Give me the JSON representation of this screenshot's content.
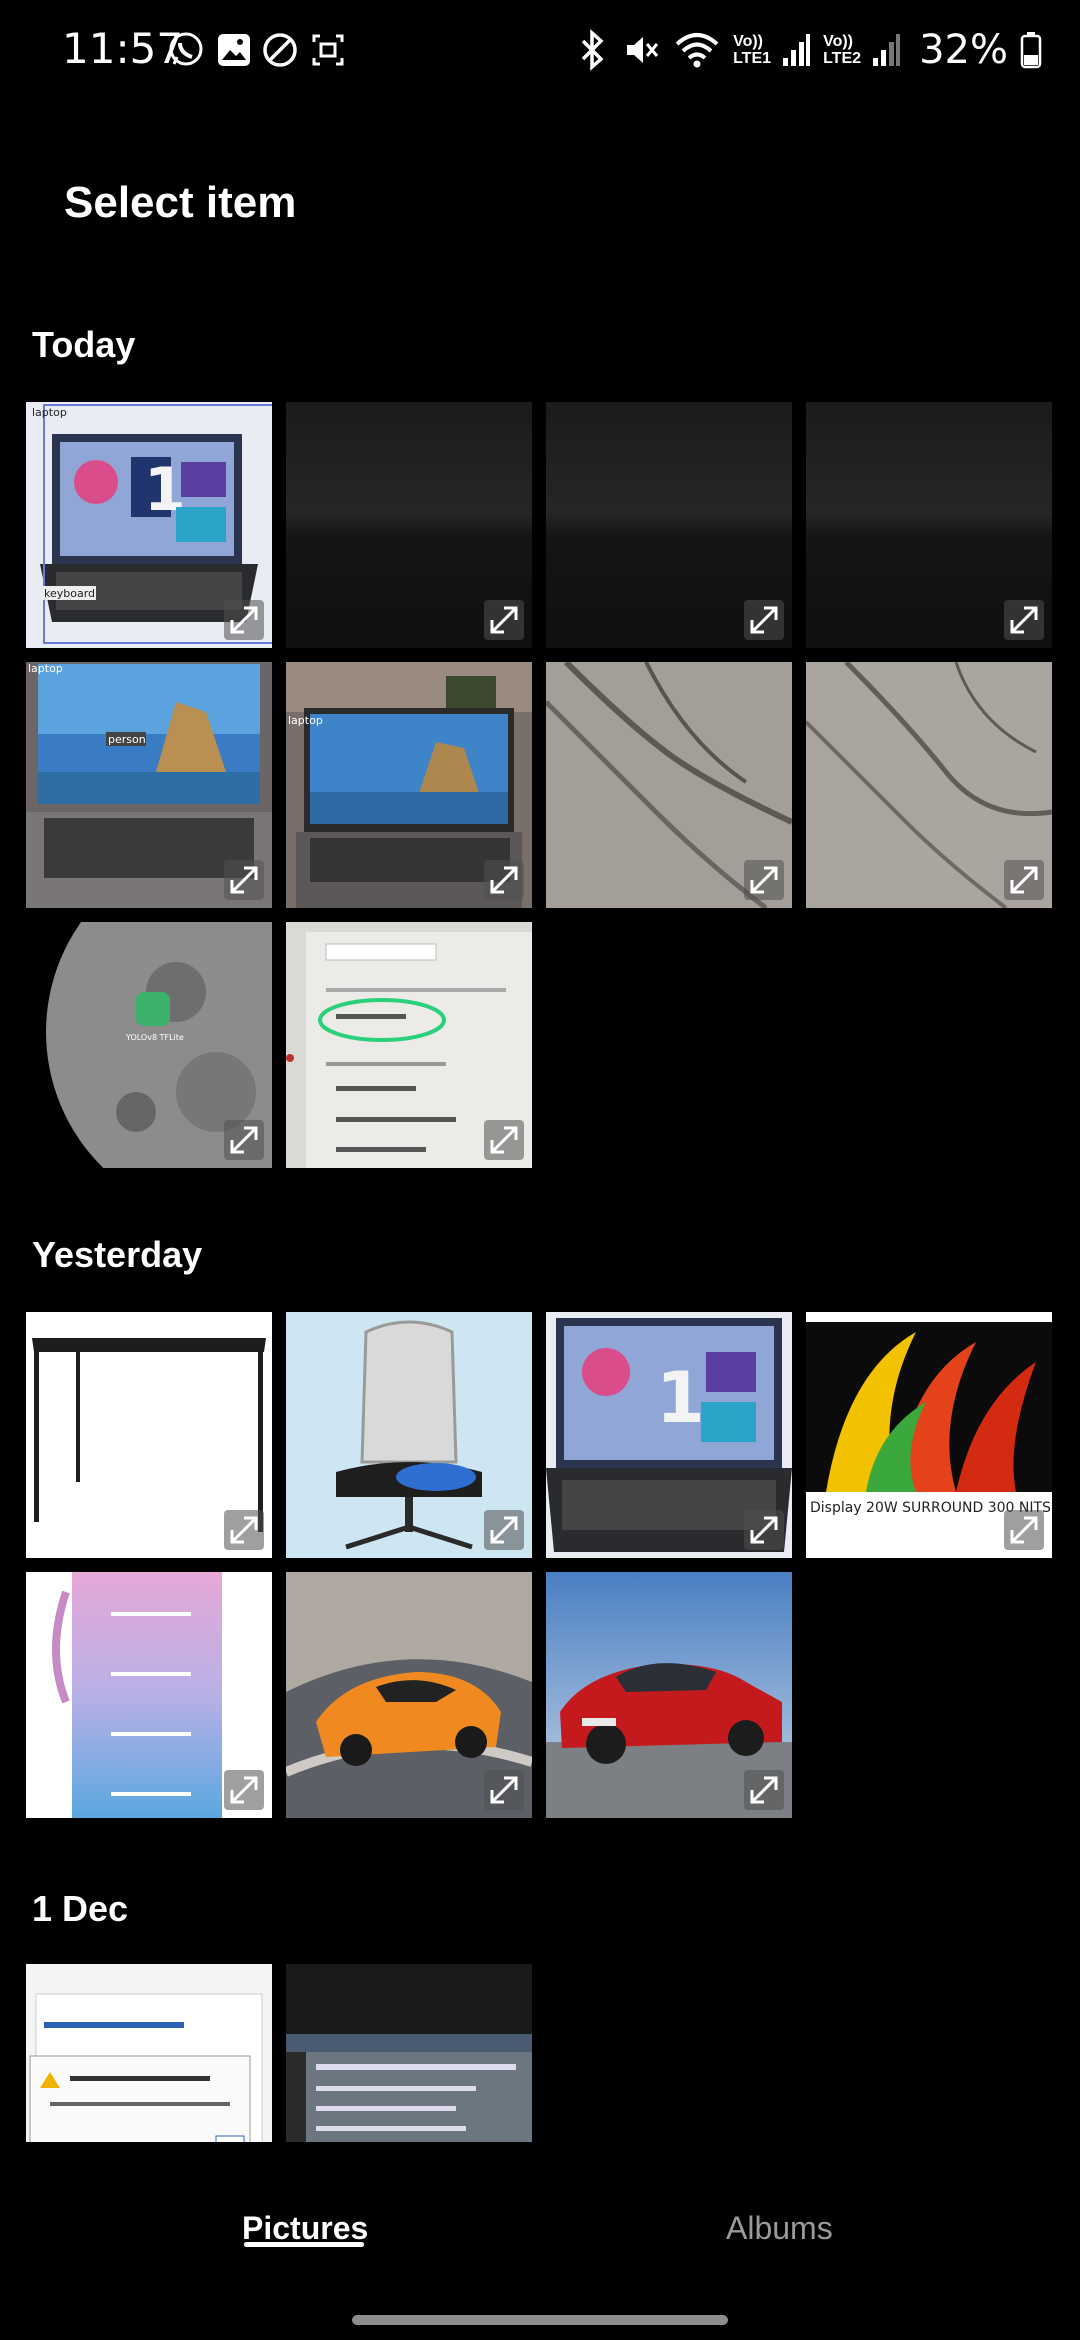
{
  "status_bar": {
    "time": "11:57",
    "battery_percent": "32%",
    "sim1_label": "Vo)) LTE1",
    "sim2_label": "Vo)) LTE2"
  },
  "header": {
    "title": "Select item"
  },
  "sections": {
    "today": "Today",
    "yesterday": "Yesterday",
    "dec1": "1 Dec"
  },
  "thumbnails": {
    "t1_labels": [
      "laptop",
      "keyboard"
    ],
    "t5_labels": [
      "laptop",
      "person"
    ],
    "t6_label": "laptop",
    "y4_text": "Display  20W SURROUND  300 NITS"
  },
  "tabs": {
    "pictures": "Pictures",
    "albums": "Albums"
  },
  "colors": {
    "background": "#000000",
    "inactive_tab": "#9a9a9a"
  }
}
